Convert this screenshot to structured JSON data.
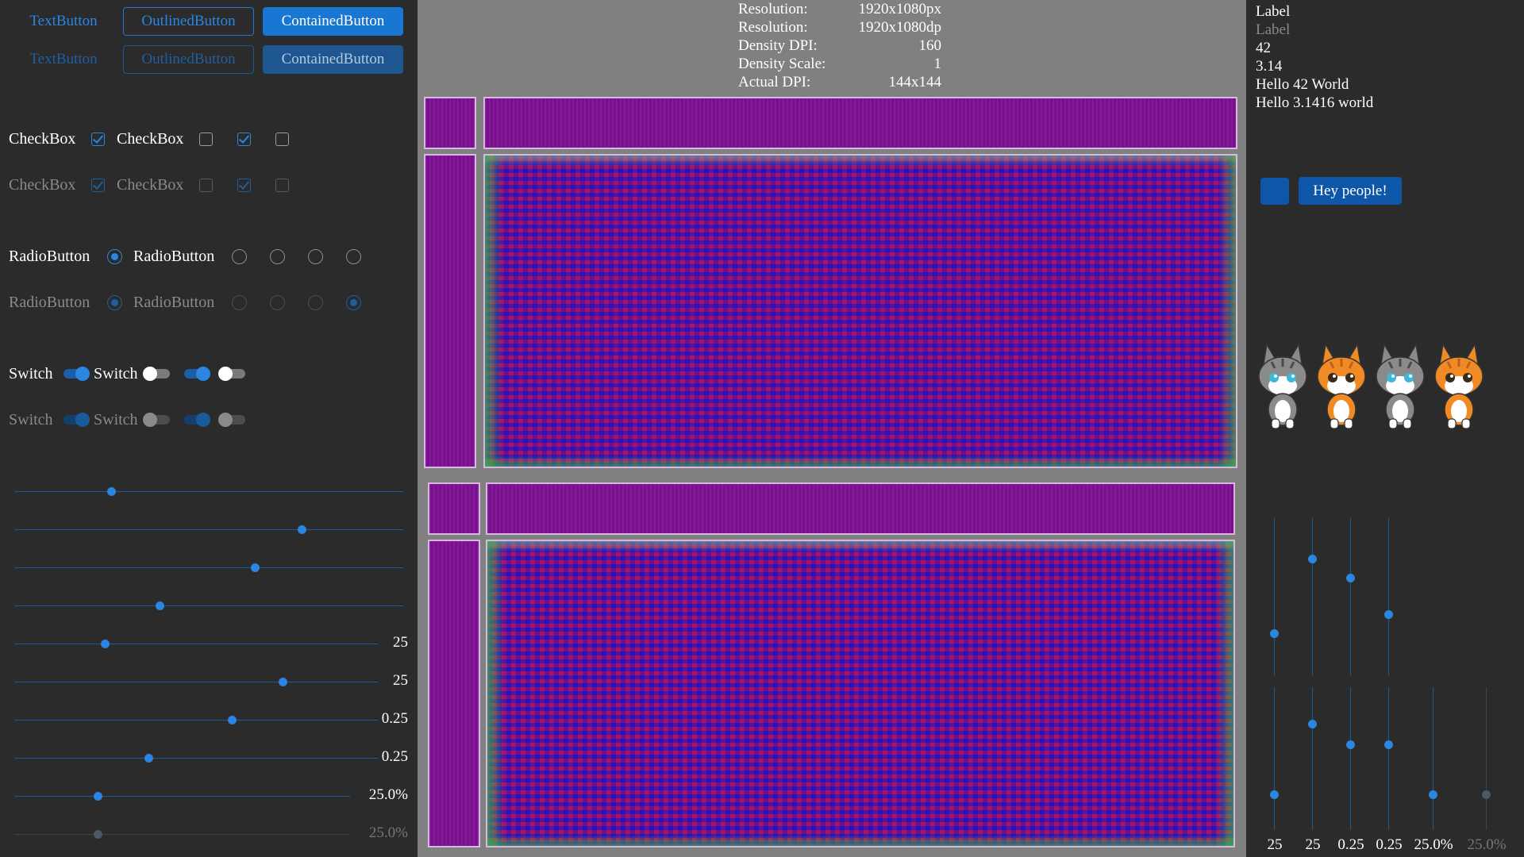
{
  "buttons": {
    "text": "TextButton",
    "outlined": "OutlinedButton",
    "contained": "ContainedButton"
  },
  "checkbox": {
    "label": "CheckBox",
    "enabled_states": [
      true,
      false,
      true,
      false
    ],
    "disabled_states": [
      true,
      false,
      true,
      false
    ]
  },
  "radio": {
    "label": "RadioButton",
    "enabled_selected_index": 0,
    "disabled_selected_index": 5
  },
  "switch": {
    "label": "Switch",
    "states": [
      true,
      false,
      true,
      false
    ]
  },
  "horizontal_sliders": [
    {
      "value": 0.25,
      "label": ""
    },
    {
      "value": 0.74,
      "label": ""
    },
    {
      "value": 0.62,
      "label": ""
    },
    {
      "value": 0.375,
      "label": ""
    },
    {
      "value": 0.25,
      "label": "25"
    },
    {
      "value": 0.74,
      "label": "25"
    },
    {
      "value": 0.6,
      "label": "0.25"
    },
    {
      "value": 0.37,
      "label": "0.25"
    },
    {
      "value": 0.25,
      "label": "25.0%"
    },
    {
      "value": 0.25,
      "label": "25.0%",
      "disabled": true
    }
  ],
  "display_info": [
    {
      "key": "Resolution:",
      "value": "1920x1080px"
    },
    {
      "key": "Resolution:",
      "value": "1920x1080dp"
    },
    {
      "key": "Density DPI:",
      "value": "160"
    },
    {
      "key": "Density Scale:",
      "value": "1"
    },
    {
      "key": "Actual DPI:",
      "value": "144x144"
    }
  ],
  "right_labels": {
    "label": "Label",
    "label_disabled": "Label",
    "int_value": "42",
    "float_value": "3.14",
    "hello_int": "Hello 42 World",
    "hello_float": "Hello 3.1416 world"
  },
  "hey_button": "Hey people!",
  "cats": [
    {
      "icon": "gray-cat-icon"
    },
    {
      "icon": "orange-cat-icon"
    },
    {
      "icon": "gray-cat-icon"
    },
    {
      "icon": "orange-cat-icon"
    }
  ],
  "vertical_sliders_top": [
    {
      "value": 0.27
    },
    {
      "value": 0.74
    },
    {
      "value": 0.62
    },
    {
      "value": 0.39
    }
  ],
  "vertical_sliders_bottom": [
    {
      "value": 0.25,
      "label": "25"
    },
    {
      "value": 0.74,
      "label": "25"
    },
    {
      "value": 0.6,
      "label": "0.25"
    },
    {
      "value": 0.6,
      "label": "0.25"
    },
    {
      "value": 0.25,
      "label": "25.0%"
    },
    {
      "value": 0.25,
      "label": "25.0%",
      "disabled": true
    }
  ],
  "colors": {
    "accent": "#1976d2",
    "panel_bg": "#2b2b2b",
    "center_bg": "#808080",
    "texture_magenta": "#7a1090"
  }
}
